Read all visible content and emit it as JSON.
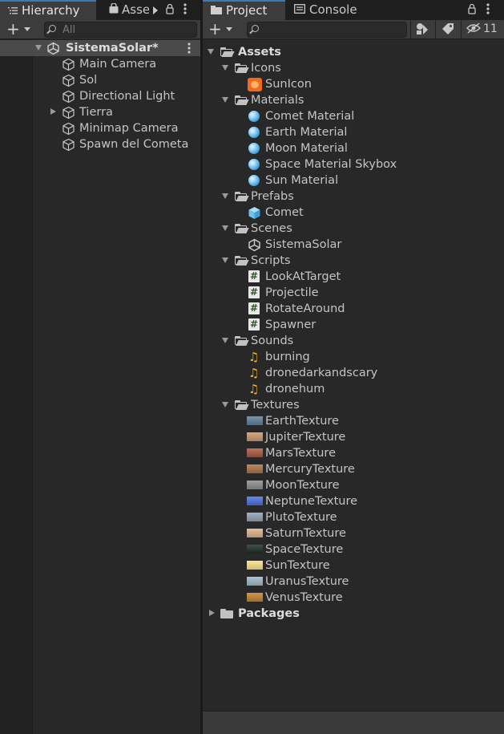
{
  "hierarchy": {
    "tab_label": "Hierarchy",
    "tab2_label": "Asse",
    "search_placeholder": "All",
    "scene_name": "SistemaSolar*",
    "items": [
      {
        "label": "Main Camera"
      },
      {
        "label": "Sol"
      },
      {
        "label": "Directional Light"
      },
      {
        "label": "Tierra"
      },
      {
        "label": "Minimap Camera"
      },
      {
        "label": "Spawn del Cometa"
      }
    ]
  },
  "project": {
    "tab_label": "Project",
    "console_tab_label": "Console",
    "hidden_count": "11",
    "tree": {
      "assets": "Assets",
      "icons": "Icons",
      "sun_icon": "SunIcon",
      "materials": "Materials",
      "material_items": [
        "Comet Material",
        "Earth Material",
        "Moon Material",
        "Space Material Skybox",
        "Sun Material"
      ],
      "prefabs": "Prefabs",
      "comet": "Comet",
      "scenes": "Scenes",
      "sistema_solar": "SistemaSolar",
      "scripts": "Scripts",
      "script_items": [
        "LookAtTarget",
        "Projectile",
        "RotateAround",
        "Spawner"
      ],
      "sounds": "Sounds",
      "sound_items": [
        "burning",
        "dronedarkandscary",
        "dronehum"
      ],
      "textures": "Textures",
      "texture_items": [
        {
          "label": "EarthTexture",
          "color": "#5a7f9a"
        },
        {
          "label": "JupiterTexture",
          "color": "#c8956a"
        },
        {
          "label": "MarsTexture",
          "color": "#a8543c"
        },
        {
          "label": "MercuryTexture",
          "color": "#a9713f"
        },
        {
          "label": "MoonTexture",
          "color": "#8a8a8a"
        },
        {
          "label": "NeptuneTexture",
          "color": "#4a6ed8"
        },
        {
          "label": "PlutoTexture",
          "color": "#8f9faf"
        },
        {
          "label": "SaturnTexture",
          "color": "#d9b08a"
        },
        {
          "label": "SpaceTexture",
          "color": "#1c2a22"
        },
        {
          "label": "SunTexture",
          "color": "#f6e08a"
        },
        {
          "label": "UranusTexture",
          "color": "#9ab6c2"
        },
        {
          "label": "VenusTexture",
          "color": "#c3802e"
        }
      ],
      "packages": "Packages"
    }
  },
  "colors": {
    "accent": "#3a79bb",
    "panel_bg": "#282828",
    "toolbar_bg": "#3c3c3c",
    "selected_row": "#4a4a4a",
    "sound_icon": "#f2b62a",
    "material_icon": "#8fd0f4",
    "prefab_icon": "#6fc2ee"
  }
}
